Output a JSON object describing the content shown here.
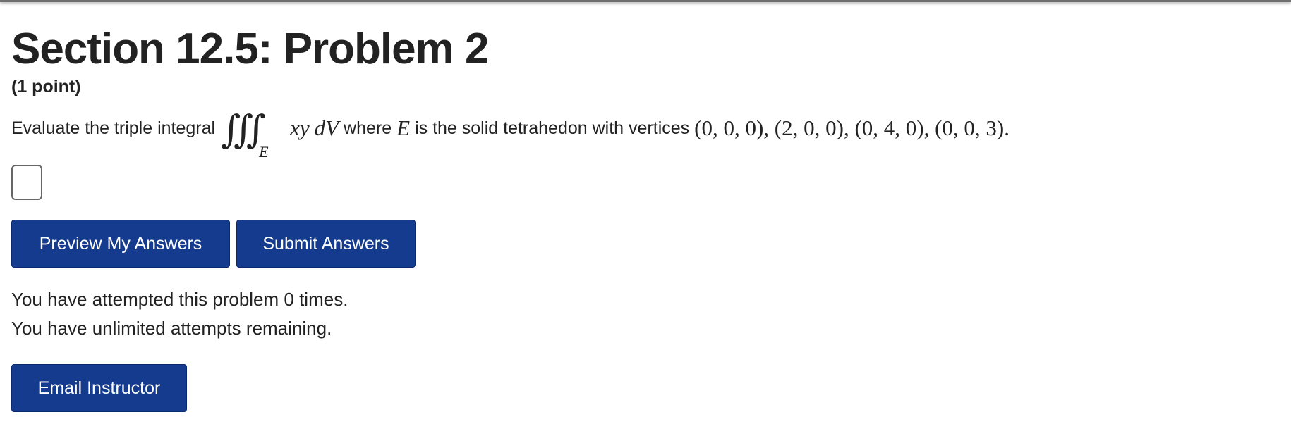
{
  "page": {
    "title": "Section 12.5: Problem 2",
    "points": "(1 point)"
  },
  "problem": {
    "prefix": "Evaluate the triple integral",
    "integral_symbol": "∭",
    "integral_subscript": "E",
    "integrand_xy": "xy",
    "integrand_dV": "dV",
    "where": "where",
    "set_variable": "E",
    "description": "is the solid tetrahedon with vertices",
    "vertices": "(0, 0, 0), (2, 0, 0), (0, 4, 0), (0, 0, 3)."
  },
  "answer": {
    "value": ""
  },
  "buttons": {
    "preview": "Preview My Answers",
    "submit": "Submit Answers",
    "email": "Email Instructor"
  },
  "status": {
    "attempted": "You have attempted this problem 0 times.",
    "remaining": "You have unlimited attempts remaining."
  },
  "colors": {
    "button_background": "#153b8f",
    "button_text": "#ffffff",
    "text": "#222222",
    "input_border": "#666666"
  }
}
